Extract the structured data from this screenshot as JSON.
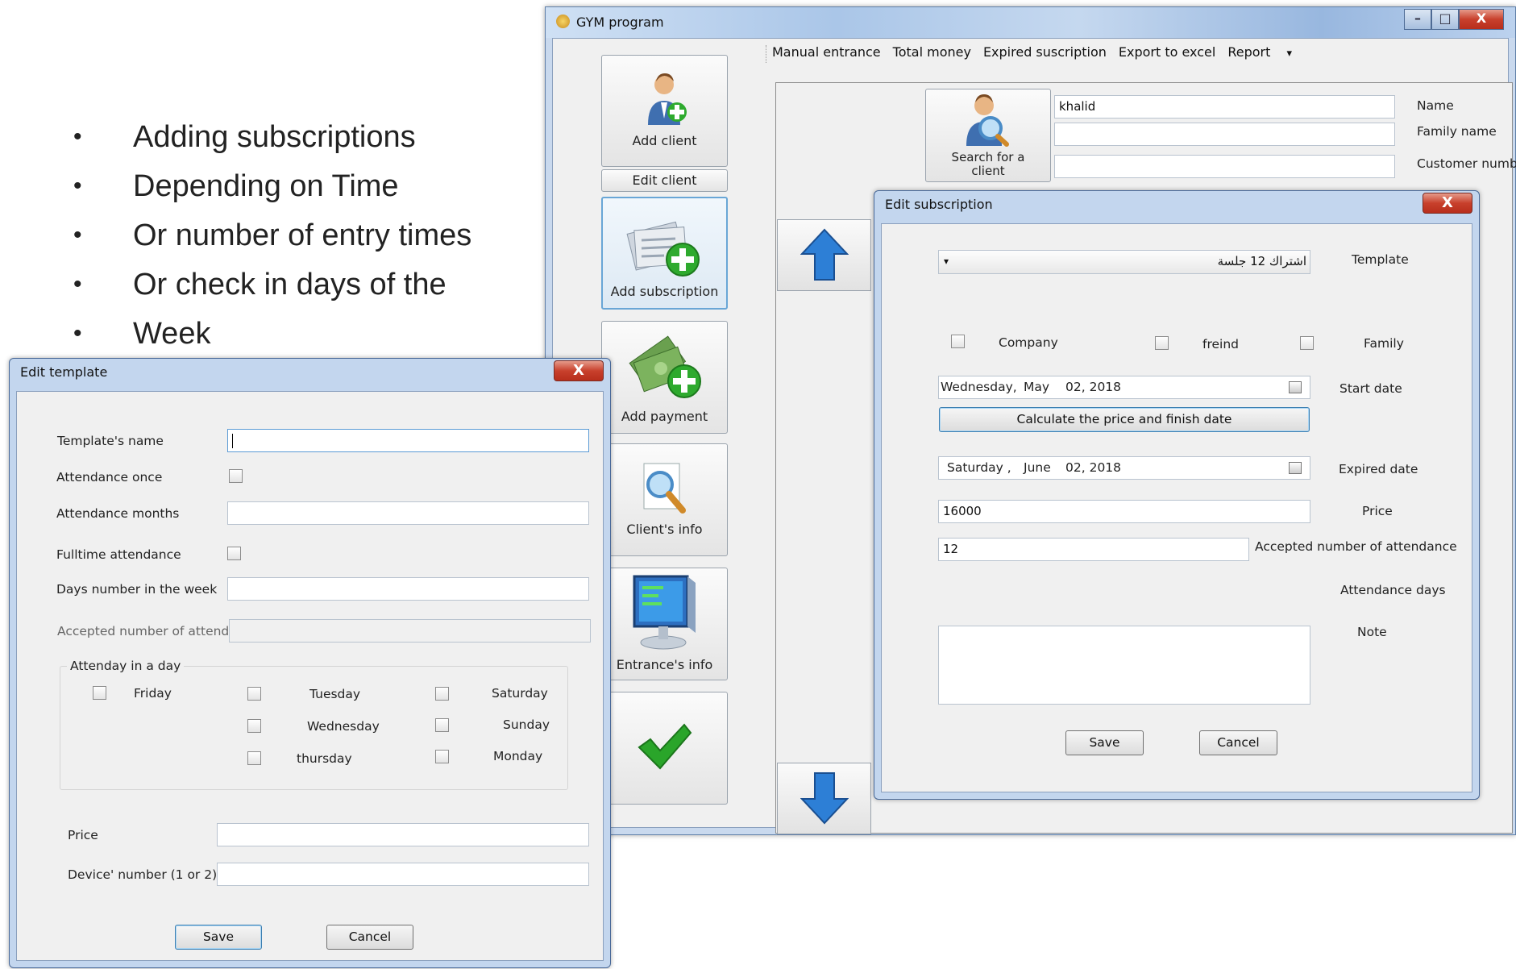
{
  "bullets": [
    "Adding subscriptions",
    "Depending on Time",
    "Or number of entry times",
    "Or check in days of the",
    "Week"
  ],
  "bullet_glyph": "•",
  "gym": {
    "title": "GYM program",
    "caption_buttons": {
      "minimize": "–",
      "maximize": "□",
      "close": "X"
    },
    "menu": [
      "Manual entrance",
      "Total money",
      "Expired suscription",
      "Export to excel",
      "Report"
    ],
    "menu_arrow": "▾",
    "sidebar": [
      {
        "label": "Add client",
        "icon": "add-user-icon"
      },
      {
        "label": "Edit client"
      },
      {
        "label": "Add subscription",
        "icon": "add-document-icon"
      },
      {
        "label": "Add payment",
        "icon": "add-money-icon"
      },
      {
        "label": "Client's info",
        "icon": "magnifier-icon"
      },
      {
        "label": "Entrance's info",
        "icon": "monitor-icon"
      },
      {
        "label": "",
        "icon": "checkmark-icon"
      }
    ],
    "search_button": "Search for a client",
    "form": {
      "name_value": "khalid",
      "labels": [
        "Name",
        "Family name",
        "Customer number"
      ]
    }
  },
  "subscription": {
    "title": "Edit subscription",
    "close": "X",
    "template_value": "اشتراك 12 جلسة",
    "template_arrow": "▾",
    "template_label": "Template",
    "checks": [
      "Company",
      "freind",
      "Family"
    ],
    "start_date": {
      "day": "Wednesday,",
      "month": "May",
      "date": "02, 2018"
    },
    "start_label": "Start date",
    "calc_button": "Calculate the price and finish date",
    "expired_date": {
      "day": "Saturday ,",
      "month": "June",
      "date": "02, 2018"
    },
    "expired_label": "Expired date",
    "price_value": "16000",
    "price_label": "Price",
    "attendance_value": "12",
    "attendance_label": "Accepted number of attendance",
    "days_label": "Attendance days",
    "note_label": "Note",
    "save": "Save",
    "cancel": "Cancel"
  },
  "template": {
    "title": "Edit template",
    "close": "X",
    "labels": {
      "name": "Template's name",
      "once": "Attendance once",
      "months": "Attendance months",
      "fulltime": "Fulltime attendance",
      "days": "Days number in the week",
      "accepted": "Accepted number of attenda"
    },
    "group_title": "Attenday in a day",
    "days": [
      "Friday",
      "Tuesday",
      "Saturday",
      "Wednesday",
      "Sunday",
      "thursday",
      "Monday"
    ],
    "price_label": "Price",
    "device_label": "Device' number (1 or 2)",
    "save": "Save",
    "cancel": "Cancel"
  },
  "colors": {
    "accent": "#3c7fb1",
    "titlebar": "#aac3e3",
    "close": "#c8402c",
    "arrow": "#2d7fd6",
    "check": "#2aa52a"
  }
}
